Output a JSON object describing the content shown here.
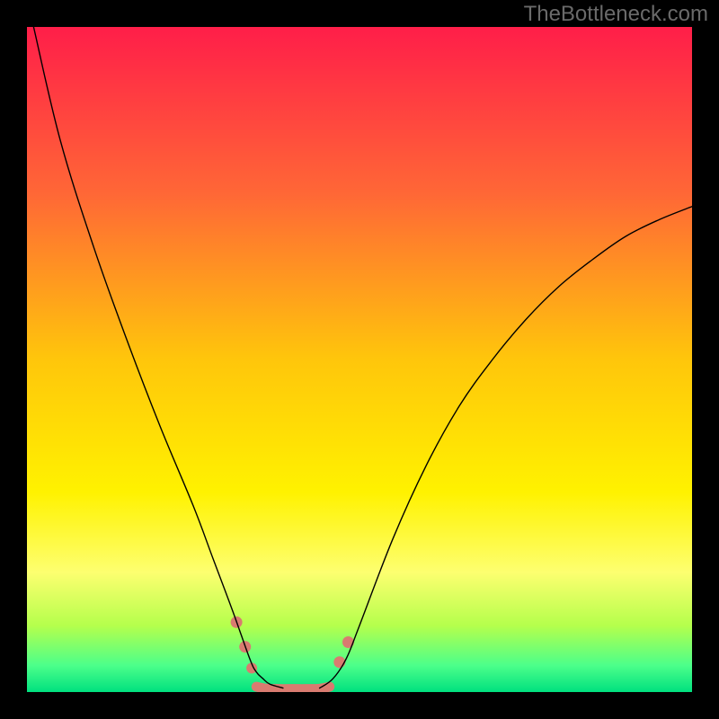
{
  "watermark": "TheBottleneck.com",
  "chart_data": {
    "type": "line",
    "title": "",
    "xlabel": "",
    "ylabel": "",
    "xlim": [
      0,
      100
    ],
    "ylim": [
      0,
      100
    ],
    "grid": false,
    "legend": false,
    "background_gradient": {
      "direction": "vertical",
      "stops": [
        {
          "pos": 0.0,
          "color": "#ff1e49"
        },
        {
          "pos": 0.25,
          "color": "#ff6736"
        },
        {
          "pos": 0.5,
          "color": "#ffc60b"
        },
        {
          "pos": 0.7,
          "color": "#fff200"
        },
        {
          "pos": 0.82,
          "color": "#fdff70"
        },
        {
          "pos": 0.9,
          "color": "#b5ff4c"
        },
        {
          "pos": 0.96,
          "color": "#4cff8a"
        },
        {
          "pos": 1.0,
          "color": "#00e07f"
        }
      ]
    },
    "series": [
      {
        "name": "left-curve",
        "color": "#000000",
        "stroke_width": 1.4,
        "x": [
          1,
          5,
          10,
          15,
          20,
          25,
          28,
          31,
          33.5,
          34.5,
          35.5,
          36.5,
          38.5
        ],
        "y": [
          100,
          83,
          67,
          53,
          40,
          28,
          20,
          12,
          5,
          3,
          2,
          1.2,
          0.6
        ]
      },
      {
        "name": "right-curve",
        "color": "#000000",
        "stroke_width": 1.4,
        "x": [
          44,
          46,
          48,
          50,
          55,
          60,
          65,
          70,
          75,
          80,
          85,
          90,
          95,
          100
        ],
        "y": [
          0.6,
          2,
          5,
          10,
          23,
          34,
          43,
          50,
          56,
          61,
          65,
          68.5,
          71,
          73
        ]
      },
      {
        "name": "flat-region",
        "color": "#d97b70",
        "stroke_width": 11,
        "x": [
          34.5,
          36,
          38,
          40,
          42,
          44,
          45.5
        ],
        "y": [
          0.8,
          0.5,
          0.45,
          0.45,
          0.45,
          0.5,
          0.8
        ]
      }
    ],
    "markers": [
      {
        "x": 31.5,
        "y": 10.5,
        "r": 6.5,
        "color": "#d97b70"
      },
      {
        "x": 32.8,
        "y": 6.8,
        "r": 6.5,
        "color": "#d97b70"
      },
      {
        "x": 33.8,
        "y": 3.6,
        "r": 6.0,
        "color": "#d97b70"
      },
      {
        "x": 47.0,
        "y": 4.5,
        "r": 6.5,
        "color": "#d97b70"
      },
      {
        "x": 48.3,
        "y": 7.5,
        "r": 6.5,
        "color": "#d97b70"
      }
    ]
  }
}
